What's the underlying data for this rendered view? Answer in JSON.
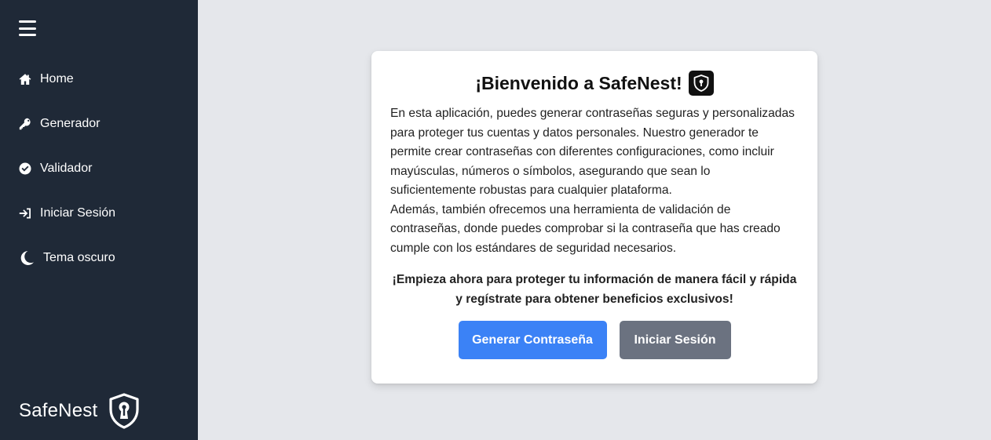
{
  "sidebar": {
    "items": [
      {
        "label": "Home",
        "icon": "home-icon"
      },
      {
        "label": "Generador",
        "icon": "key-icon"
      },
      {
        "label": "Validador",
        "icon": "check-circle-icon"
      },
      {
        "label": "Iniciar Sesión",
        "icon": "sign-in-icon"
      },
      {
        "label": "Tema oscuro",
        "icon": "moon-icon"
      }
    ],
    "brand": "SafeNest"
  },
  "card": {
    "title": "¡Bienvenido a SafeNest!",
    "description_1": "En esta aplicación, puedes generar contraseñas seguras y personalizadas para proteger tus cuentas y datos personales. Nuestro generador te permite crear contraseñas con diferentes configuraciones, como incluir mayúsculas, números o símbolos, asegurando que sean lo suficientemente robustas para cualquier plataforma.",
    "description_2": "Además, también ofrecemos una herramienta de validación de contraseñas, donde puedes comprobar si la contraseña que has creado cumple con los estándares de seguridad necesarios.",
    "cta": "¡Empieza ahora para proteger tu información de manera fácil y rápida y regístrate para obtener beneficios exclusivos!",
    "primary_button": "Generar Contraseña",
    "secondary_button": "Iniciar Sesión"
  },
  "colors": {
    "sidebar_bg": "#1f2937",
    "page_bg": "#e5e7eb",
    "primary": "#3b82f6",
    "secondary": "#6b7280"
  }
}
